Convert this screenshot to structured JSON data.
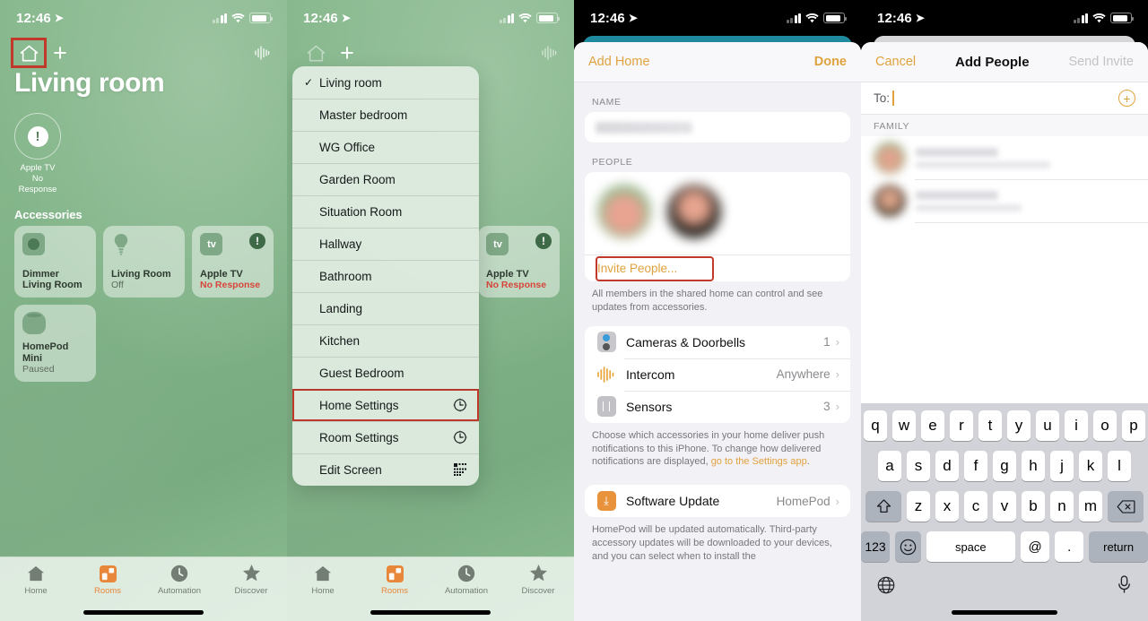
{
  "status_bar": {
    "time": "12:46",
    "location_icon": "location-arrow-icon",
    "wifi_icon": "wifi-icon",
    "battery_icon": "battery-icon"
  },
  "panel1": {
    "nav": {
      "home_icon": "home-icon",
      "add_icon": "plus-icon",
      "intercom_icon": "waveform-icon"
    },
    "room_title": "Living room",
    "status_tile": {
      "icon": "exclamation-icon",
      "name": "Apple TV",
      "state": "No Response"
    },
    "section_title": "Accessories",
    "accessories": [
      {
        "icon": "dimmer-icon",
        "name": "Dimmer\nLiving Room",
        "name_line1": "Dimmer",
        "name_line2": "Living Room",
        "state": "",
        "error": false
      },
      {
        "icon": "lightbulb-icon",
        "name_line1": "Living Room",
        "name_line2": "",
        "state": "Off",
        "error": false
      },
      {
        "icon": "apple-tv-icon",
        "name_line1": "Apple TV",
        "name_line2": "",
        "state": "No Response",
        "error": true,
        "badge": "!"
      },
      {
        "icon": "homepod-icon",
        "name_line1": "HomePod",
        "name_line2": "Mini",
        "state": "Paused",
        "error": false
      }
    ],
    "tabs": [
      {
        "label": "Home",
        "icon": "home-icon",
        "active": false
      },
      {
        "label": "Rooms",
        "icon": "rooms-icon",
        "active": true
      },
      {
        "label": "Automation",
        "icon": "clock-icon",
        "active": false
      },
      {
        "label": "Discover",
        "icon": "star-icon",
        "active": false
      }
    ]
  },
  "panel2": {
    "menu_items": [
      {
        "label": "Living room",
        "checked": true,
        "icon": ""
      },
      {
        "label": "Master bedroom",
        "checked": false,
        "icon": ""
      },
      {
        "label": "WG Office",
        "checked": false,
        "icon": ""
      },
      {
        "label": "Garden Room",
        "checked": false,
        "icon": ""
      },
      {
        "label": "Situation Room",
        "checked": false,
        "icon": ""
      },
      {
        "label": "Hallway",
        "checked": false,
        "icon": ""
      },
      {
        "label": "Bathroom",
        "checked": false,
        "icon": ""
      },
      {
        "label": "Landing",
        "checked": false,
        "icon": ""
      },
      {
        "label": "Kitchen",
        "checked": false,
        "icon": ""
      },
      {
        "label": "Guest Bedroom",
        "checked": false,
        "icon": ""
      },
      {
        "label": "Home Settings",
        "checked": false,
        "icon": "gear-clock-icon",
        "highlighted": true
      },
      {
        "label": "Room Settings",
        "checked": false,
        "icon": "gear-clock-icon"
      },
      {
        "label": "Edit Screen",
        "checked": false,
        "icon": "grid-icon"
      }
    ],
    "checkmark": "✓",
    "accessory_card": {
      "name": "Apple TV",
      "state": "No Response"
    }
  },
  "panel3": {
    "header": {
      "left": "Add Home",
      "right": "Done"
    },
    "name_section_label": "NAME",
    "name_value": "",
    "people_section_label": "PEOPLE",
    "invite_label": "Invite People...",
    "people_footnote": "All members in the shared home can control and see updates from accessories.",
    "rows": [
      {
        "label": "Cameras & Doorbells",
        "value": "1",
        "icon": "camera-doorbell-icon"
      },
      {
        "label": "Intercom",
        "value": "Anywhere",
        "icon": "intercom-waveform-icon"
      },
      {
        "label": "Sensors",
        "value": "3",
        "icon": "sensor-icon"
      }
    ],
    "notifications_footnote_pre": "Choose which accessories in your home deliver push notifications to this iPhone. To change how delivered notifications are displayed, ",
    "notifications_link": "go to the Settings app",
    "notifications_footnote_post": ".",
    "software_update": {
      "label": "Software Update",
      "value": "HomePod",
      "icon": "download-icon"
    },
    "update_footnote": "HomePod will be updated automatically. Third-party accessory updates will be downloaded to your devices, and you can select when to install the"
  },
  "panel4": {
    "header": {
      "left": "Cancel",
      "title": "Add People",
      "right": "Send Invite"
    },
    "to_label": "To:",
    "to_value": "",
    "add_contact_icon": "plus-circle-icon",
    "family_label": "FAMILY",
    "contacts": [
      {
        "name": "",
        "detail": ""
      },
      {
        "name": "",
        "detail": ""
      }
    ],
    "keyboard": {
      "row1": [
        "q",
        "w",
        "e",
        "r",
        "t",
        "y",
        "u",
        "i",
        "o",
        "p"
      ],
      "row2": [
        "a",
        "s",
        "d",
        "f",
        "g",
        "h",
        "j",
        "k",
        "l"
      ],
      "row3": [
        "z",
        "x",
        "c",
        "v",
        "b",
        "n",
        "m"
      ],
      "shift": "shift-icon",
      "backspace": "backspace-icon",
      "numbers": "123",
      "emoji": "emoji-icon",
      "space": "space",
      "at": "@",
      "period": ".",
      "return": "return",
      "globe": "globe-icon",
      "mic": "microphone-icon"
    }
  },
  "colors": {
    "accent_amber": "#e0a23e",
    "highlight_red": "#c0392b",
    "error_red": "#d8453a",
    "tab_active": "#e8873a"
  }
}
